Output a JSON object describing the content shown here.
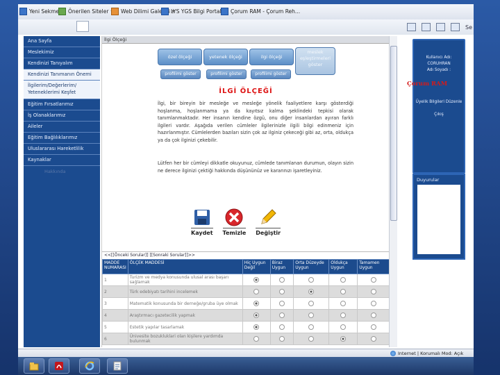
{
  "favorites": {
    "items": [
      {
        "label": "Yeni Sekme",
        "icon": "tab-icon"
      },
      {
        "label": "Önerilen Siteler",
        "icon": "suggested-sites-icon"
      },
      {
        "label": "Web Dilimi Galerisi",
        "icon": "web-slice-icon"
      },
      {
        "label": "LYS YGS Bilgi Portalı",
        "icon": "page-icon"
      },
      {
        "label": "Çorum RAM - Çorum Reh...",
        "icon": "page-icon"
      }
    ],
    "command_tail": "Se"
  },
  "left_nav": {
    "items": [
      {
        "label": "Ana Sayfa",
        "style": "dark"
      },
      {
        "label": "Meslekimiz",
        "style": "dark"
      },
      {
        "label": "Kendinizi Tanıyalım",
        "style": "dark"
      },
      {
        "label": "Kendinizi Tanımanın Önemi",
        "style": "light"
      },
      {
        "label": "İlgilerim/Değerlerim/ Yeteneklerimi Keşfet",
        "style": "light"
      },
      {
        "label": "Eğitim Fırsatlarımız",
        "style": "dark"
      },
      {
        "label": "İş Olanaklarımız",
        "style": "dark"
      },
      {
        "label": "Aileler",
        "style": "dark"
      },
      {
        "label": "Eğitim Bağlılıklarımız",
        "style": "dark"
      },
      {
        "label": "Uluslararası Hareketlilik",
        "style": "dark"
      },
      {
        "label": "Kaynaklar",
        "style": "dark"
      }
    ],
    "faded": "Hakkında"
  },
  "content": {
    "header": "İlgi Ölçeği",
    "tiles": {
      "ozel_olcegi": "özel ölçeği",
      "yetenek_olcegi": "yetenek ölçeği",
      "ilgi_olcegi": "ilgi ölçeği",
      "meslek_eslestirme": "meslek eşleştirmeleri göster"
    },
    "sub_buttons": [
      "profilimi göster",
      "profilimi göster",
      "profilimi göster"
    ],
    "title": "İLGİ ÖLÇEĞİ",
    "paragraph1": "İlgi, bir bireyin bir mesleğe ve mesleğe yönelik faaliyetlere karşı gösterdiği hoşlanma, hoşlanmama ya da kayıtsız kalma şeklindeki tepkisi olarak tanımlanmaktadır. Her insanın kendine özgü, onu diğer insanlardan ayıran farklı ilgileri vardır. Aşağıda verilen cümleler ilgilerinizle ilgili bilgi edinmeniz için hazırlanmıştır. Cümlelerden bazıları sizin çok az ilginiz çekeceği gibi az, orta, oldukça ya da çok ilginizi çekebilir.",
    "paragraph2": "Lütfen her bir cümleyi dikkatle okuyunuz, cümlede tanımlanan durumun, olayın sizin ne derece ilginizi çektiği hakkında düşününüz ve kararınızı işaretleyiniz.",
    "actions": {
      "save": "Kaydet",
      "clear": "Temizle",
      "change": "Değiştir"
    },
    "pager": "<<[[Önceki Sorular]]  [[Sonraki Sorular]]>>",
    "table": {
      "headers": [
        "MADDE NUMARASI",
        "ÖLÇEK MADDESİ",
        "Hiç Uygun Değil",
        "Biraz Uygun",
        "Orta Düzeyde Uygun",
        "Oldukça Uygun",
        "Tamamen Uygun"
      ],
      "rows": [
        {
          "num": "1",
          "text": "Turizm ve medya konusunda ulusal arası başarı sağlamak",
          "selected": 0
        },
        {
          "num": "2",
          "text": "Türk edebiyatı tarihini incelemek",
          "selected": 2
        },
        {
          "num": "3",
          "text": "Matematik konusunda bir derneğe/gruba üye olmak",
          "selected": 0
        },
        {
          "num": "4",
          "text": "Araştırmacı gazetecilik yapmak",
          "selected": 0
        },
        {
          "num": "5",
          "text": "Estetik yapılar tasarlamak",
          "selected": 0
        },
        {
          "num": "6",
          "text": "Ünivesite bozukluklari olan kişilere yardımda bulunmak",
          "selected": 3
        }
      ]
    }
  },
  "right_panel": {
    "brand": "Çorum RAM",
    "lines": [
      "Kullanıcı Adı:",
      "CORUHRAN",
      "Adı Soyadı :"
    ],
    "links": [
      "Üyelik Bilgileri Düzenle",
      "Çıkış"
    ],
    "announcements_title": "Duyurular"
  },
  "status": {
    "text": "Internet | Korumalı Mod: Açık"
  },
  "taskbar": {
    "buttons": [
      "explorer",
      "acrobat",
      "internet-explorer",
      "notepad"
    ]
  },
  "colors": {
    "nav": "#1b4b8f",
    "accent_red": "#d11111",
    "table_header": "#1c4b8d"
  }
}
